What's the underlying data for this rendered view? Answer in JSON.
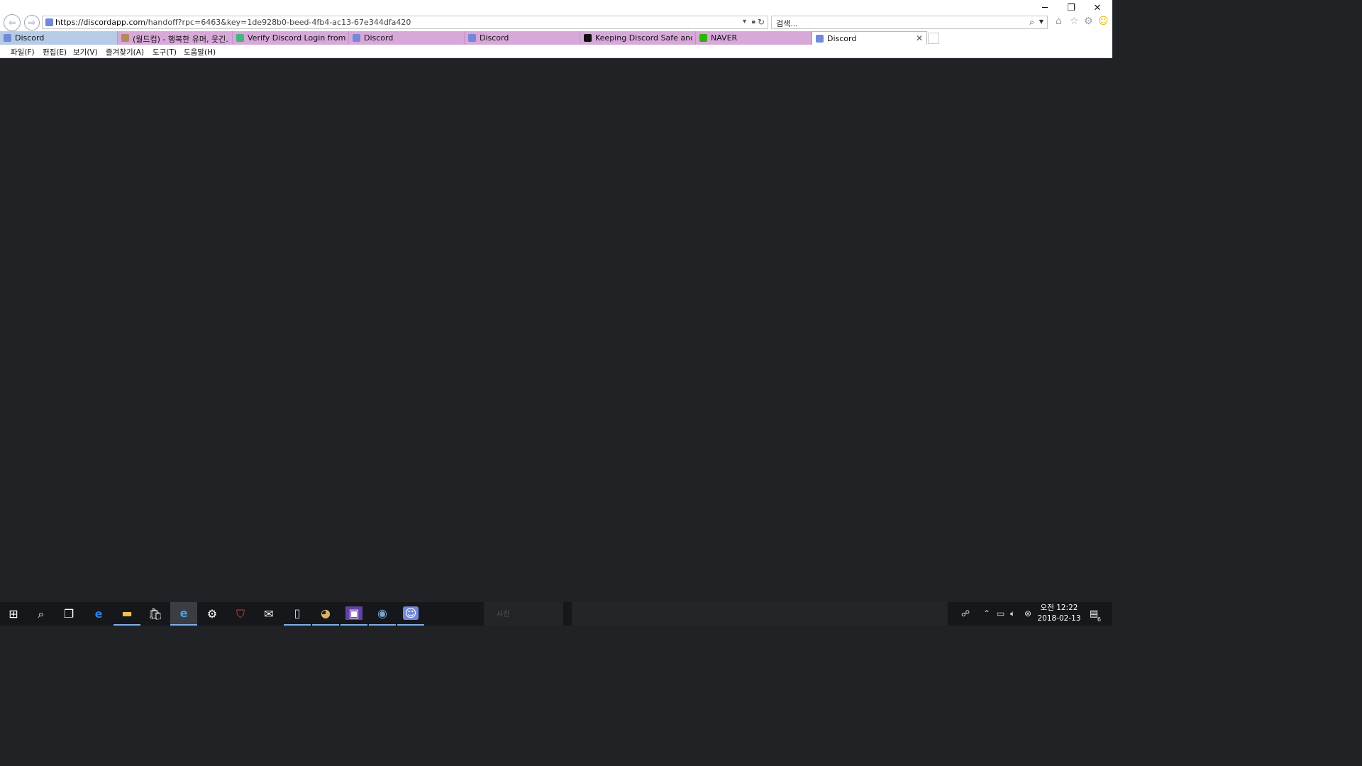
{
  "window": {
    "minimize": "─",
    "restore": "❐",
    "close": "✕"
  },
  "address": {
    "url_host": "https://discordapp.com",
    "url_path": "/handoff?rpc=6463&key=1de928b0-beed-4fb4-ac13-67e344dfa420"
  },
  "search": {
    "placeholder": "검색..."
  },
  "tabs": [
    {
      "label": "Discord",
      "icon_color": "#7289da"
    },
    {
      "label": "(월드컵) - 행복한 유머, 웃긴...",
      "icon_color": "#b08a5c"
    },
    {
      "label": "Verify Discord Login from Ne...",
      "icon_color": "#43b581"
    },
    {
      "label": "Discord",
      "icon_color": "#7289da"
    },
    {
      "label": "Discord",
      "icon_color": "#7289da"
    },
    {
      "label": "Keeping Discord Safe and So...",
      "icon_color": "#111111"
    },
    {
      "label": "NAVER",
      "icon_color": "#2db400"
    },
    {
      "label": "Discord",
      "icon_color": "#7289da"
    }
  ],
  "menu": [
    "파일(F)",
    "편집(E)",
    "보기(V)",
    "즐겨찾기(A)",
    "도구(T)",
    "도움말(H)"
  ],
  "taskbar": {
    "ghost_label": "사진",
    "clock_time": "오전 12:22",
    "clock_date": "2018-02-13",
    "notification_count": "6"
  },
  "colors": {
    "page_bg": "#202225",
    "taskbar_bg": "#15171b",
    "tab_inactive": "#d7a9d9",
    "tab_first": "#b6cbe6"
  }
}
